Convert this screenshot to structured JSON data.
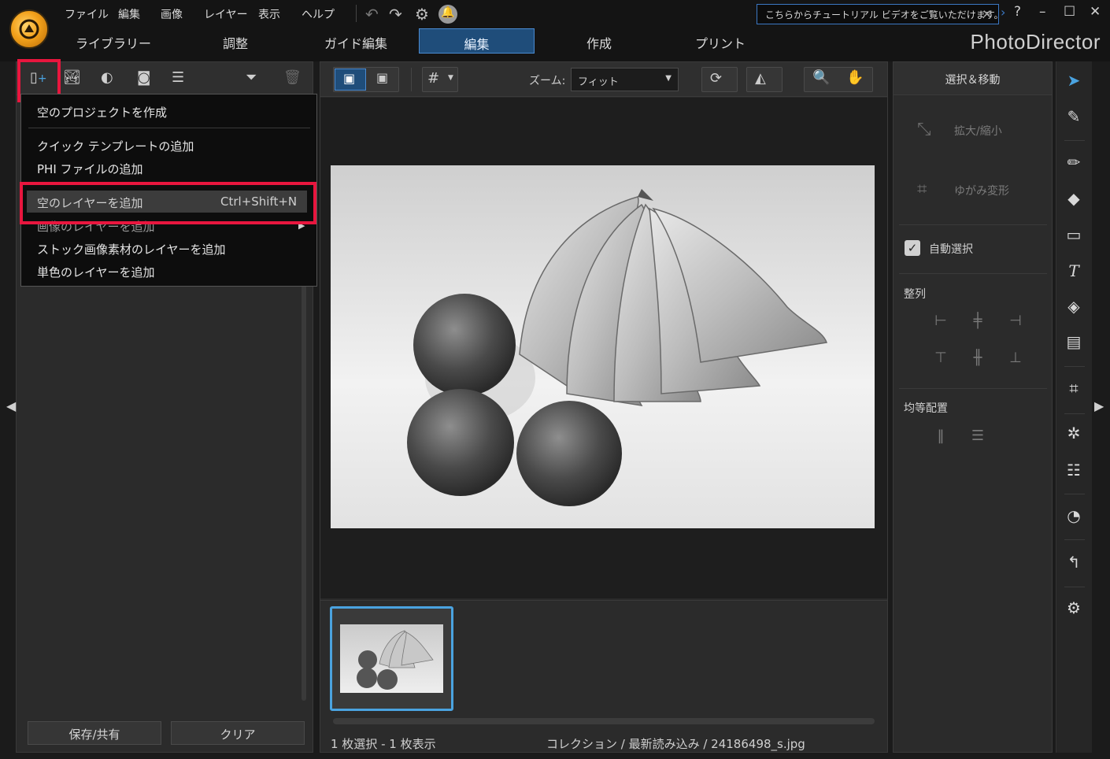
{
  "menubar": {
    "items": [
      "ファイル",
      "編集",
      "画像",
      "レイヤー",
      "表示",
      "ヘルプ"
    ],
    "tutorial_text": "こちらからチュートリアル ビデオをご覧いただけます。",
    "help": "?"
  },
  "nav_tabs": [
    "ライブラリー",
    "調整",
    "ガイド編集",
    "編集",
    "作成",
    "プリント"
  ],
  "brand": "PhotoDirector",
  "left_panel": {
    "buttons": {
      "save": "保存/共有",
      "clear": "クリア"
    }
  },
  "dropdown": {
    "items": [
      "空のプロジェクトを作成",
      "クイック テンプレートの追加",
      "PHI ファイルの追加",
      "空のレイヤーを追加",
      "画像のレイヤーを追加",
      "ストック画像素材のレイヤーを追加",
      "単色のレイヤーを追加"
    ],
    "shortcut": "Ctrl+Shift+N"
  },
  "center": {
    "zoom_label": "ズーム:",
    "zoom_value": "フィット",
    "status_left": "1 枚選択 - 1 枚表示",
    "status_path": "コレクション / 最新読み込み / 24186498_s.jpg"
  },
  "right_panel": {
    "title": "選択＆移動",
    "scale": "拡大/縮小",
    "distort": "ゆがみ変形",
    "auto_select": "自動選択",
    "align_label": "整列",
    "distribute_label": "均等配置"
  },
  "colors": {
    "accent_blue": "#4aa3e0",
    "highlight_red": "#e8163e",
    "logo_orange": "#f2a11b"
  }
}
